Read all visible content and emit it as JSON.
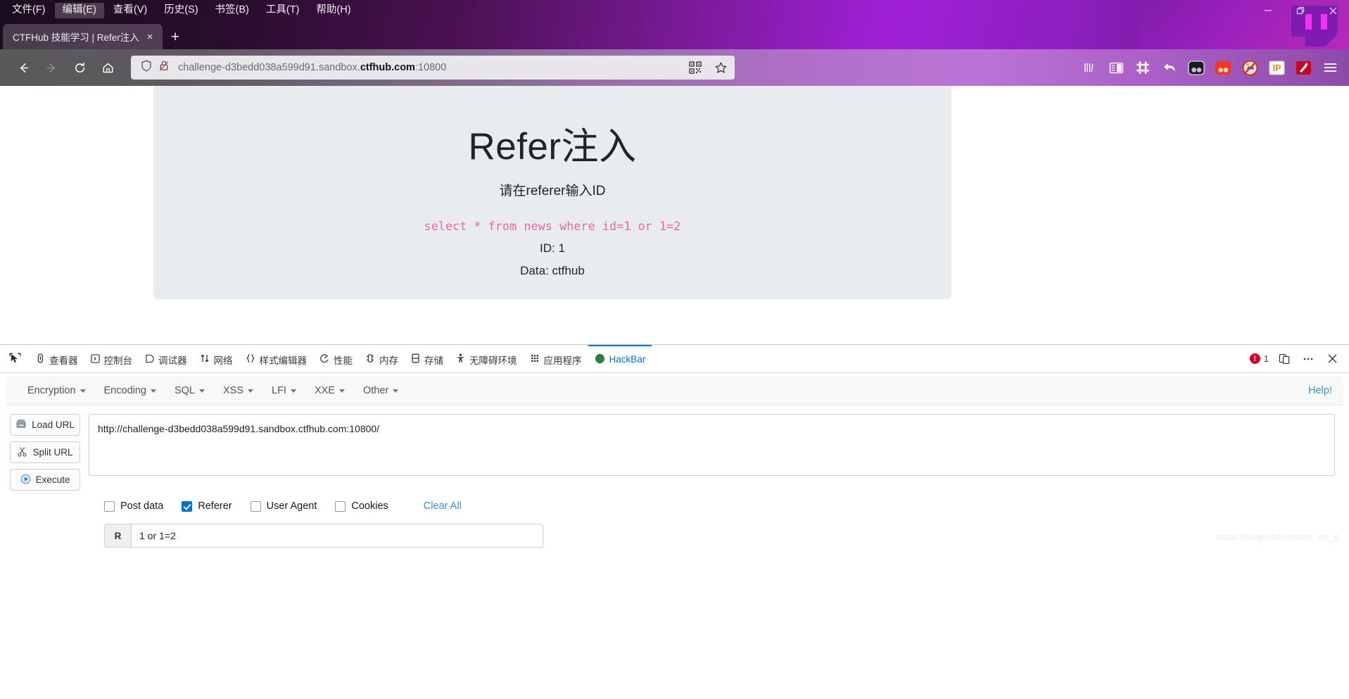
{
  "window": {
    "menus": [
      {
        "label": "文件(F)",
        "active": false
      },
      {
        "label": "编辑(E)",
        "active": true
      },
      {
        "label": "查看(V)",
        "active": false
      },
      {
        "label": "历史(S)",
        "active": false
      },
      {
        "label": "书签(B)",
        "active": false
      },
      {
        "label": "工具(T)",
        "active": false
      },
      {
        "label": "帮助(H)",
        "active": false
      }
    ],
    "controls": {
      "minimize": "–",
      "restore": "❐",
      "close": "×"
    }
  },
  "tabs": {
    "items": [
      {
        "title": "CTFHub 技能学习 | Refer注入",
        "close": "×"
      }
    ],
    "new_tab": "+"
  },
  "nav": {
    "back": "back-arrow",
    "forward": "forward-arrow",
    "reload": "reload-icon",
    "home": "home-icon"
  },
  "urlbar": {
    "shield_icon": "shield-icon",
    "lock_icon": "lock-broken-icon",
    "url_prefix": "challenge-d3bedd038a599d91.sandbox.",
    "url_domain": "ctfhub.com",
    "url_suffix": ":10800",
    "qr_icon": "qr-code-icon",
    "bookmark_icon": "star-icon",
    "extensions": [
      "library-icon",
      "sidebar-icon",
      "crop-icon",
      "undo-icon",
      "dark-reader-icon",
      "moon-reader-icon",
      "noscript-icon",
      "ip-badge-icon",
      "magic-wand-icon",
      "hamburger-menu-icon"
    ]
  },
  "page": {
    "title": "Refer注入",
    "subtitle": "请在referer输入ID",
    "sql": "select * from news where id=1 or 1=2",
    "id_line": "ID: 1",
    "data_line": "Data: ctfhub"
  },
  "devtools": {
    "picker_icon": "element-picker-icon",
    "tabs": [
      {
        "label": "查看器",
        "icon": "inspector-icon",
        "active": false
      },
      {
        "label": "控制台",
        "icon": "console-icon",
        "active": false
      },
      {
        "label": "调试器",
        "icon": "debugger-icon",
        "active": false
      },
      {
        "label": "网络",
        "icon": "network-icon",
        "active": false
      },
      {
        "label": "样式编辑器",
        "icon": "style-editor-icon",
        "active": false
      },
      {
        "label": "性能",
        "icon": "performance-icon",
        "active": false
      },
      {
        "label": "内存",
        "icon": "memory-icon",
        "active": false
      },
      {
        "label": "存储",
        "icon": "storage-icon",
        "active": false
      },
      {
        "label": "无障碍环境",
        "icon": "accessibility-icon",
        "active": false
      },
      {
        "label": "应用程序",
        "icon": "application-icon",
        "active": false
      },
      {
        "label": "HackBar",
        "icon": "hackbar-icon",
        "active": true
      }
    ],
    "error_count": "1",
    "responsive_icon": "responsive-mode-icon",
    "more_icon": "meatball-menu-icon",
    "close_icon": "close-icon",
    "accent_color": "#0074e8",
    "error_color": "#d70022"
  },
  "hackbar": {
    "menus": [
      "Encryption",
      "Encoding",
      "SQL",
      "XSS",
      "LFI",
      "XXE",
      "Other"
    ],
    "help_label": "Help!",
    "buttons": [
      {
        "label": "Load URL",
        "icon": "disk-icon"
      },
      {
        "label": "Split URL",
        "icon": "scissors-icon"
      },
      {
        "label": "Execute",
        "icon": "play-icon"
      }
    ],
    "url_value": "http://challenge-d3bedd038a599d91.sandbox.ctfhub.com:10800/",
    "url_placeholder": "",
    "checkboxes": [
      {
        "label": "Post data",
        "checked": false
      },
      {
        "label": "Referer",
        "checked": true
      },
      {
        "label": "User Agent",
        "checked": false
      },
      {
        "label": "Cookies",
        "checked": false
      }
    ],
    "clear_all_label": "Clear All",
    "referer_prefix": "R",
    "referer_value": "1 or 1=2",
    "referer_placeholder": "",
    "link_color": "#3b8fd4"
  },
  "watermark": "https://blog.csdn.net/m_de_g"
}
